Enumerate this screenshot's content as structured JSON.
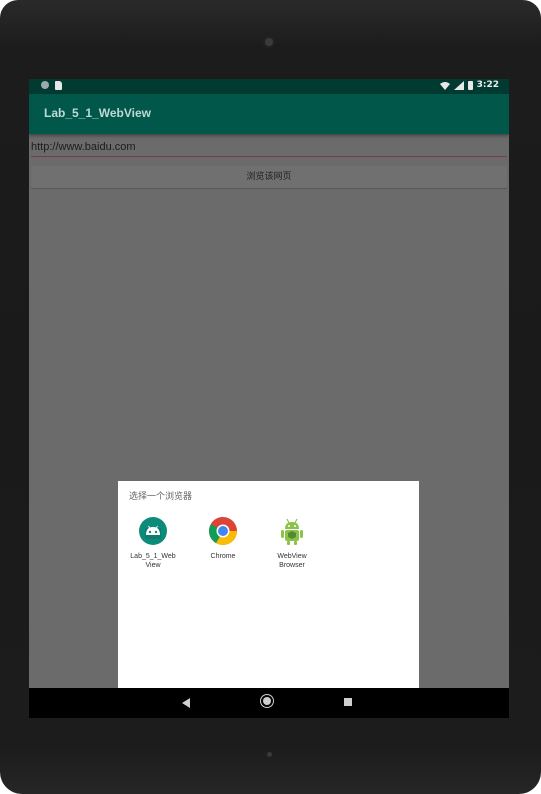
{
  "status_bar": {
    "time": "3:22"
  },
  "app_bar": {
    "title": "Lab_5_1_WebView"
  },
  "url_field": {
    "value": "http://www.baidu.com"
  },
  "browse_button": {
    "label": "浏览该网页"
  },
  "chooser": {
    "title": "选择一个浏览器",
    "apps": [
      {
        "label_line1": "Lab_5_1_Web",
        "label_line2": "View",
        "icon": "android-robot-icon"
      },
      {
        "label_line1": "Chrome",
        "label_line2": "",
        "icon": "chrome-icon"
      },
      {
        "label_line1": "WebView",
        "label_line2": "Browser",
        "icon": "android-webview-icon"
      }
    ]
  },
  "nav_bar": {
    "items": [
      "back-icon",
      "home-icon",
      "recents-icon"
    ]
  },
  "colors": {
    "status_bar": "#003a30",
    "app_bar": "#00574a",
    "screen_dim": "#6b6b6b",
    "url_underline": "#7a3a52"
  }
}
